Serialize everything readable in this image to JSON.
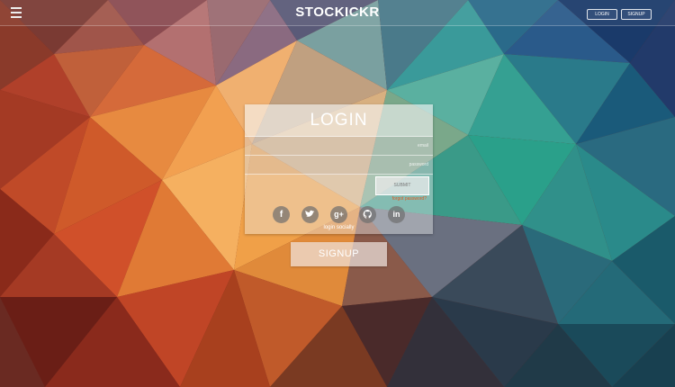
{
  "header": {
    "brand": "STOCKICKR",
    "login_label": "LOGIN",
    "signup_label": "SIGNUP"
  },
  "login_card": {
    "title": "LOGIN",
    "email_placeholder": "email",
    "password_placeholder": "password",
    "submit_label": "SUBMIT",
    "forgot_label": "forgot password?",
    "social_label": "login socially",
    "social_icons": [
      "facebook-icon",
      "twitter-icon",
      "google-plus-icon",
      "github-icon",
      "linkedin-icon"
    ]
  },
  "signup_button": {
    "label": "SIGNUP"
  },
  "colors": {
    "accent": "#e05a20",
    "card": "#ebebeb",
    "text": "#ffffff"
  }
}
